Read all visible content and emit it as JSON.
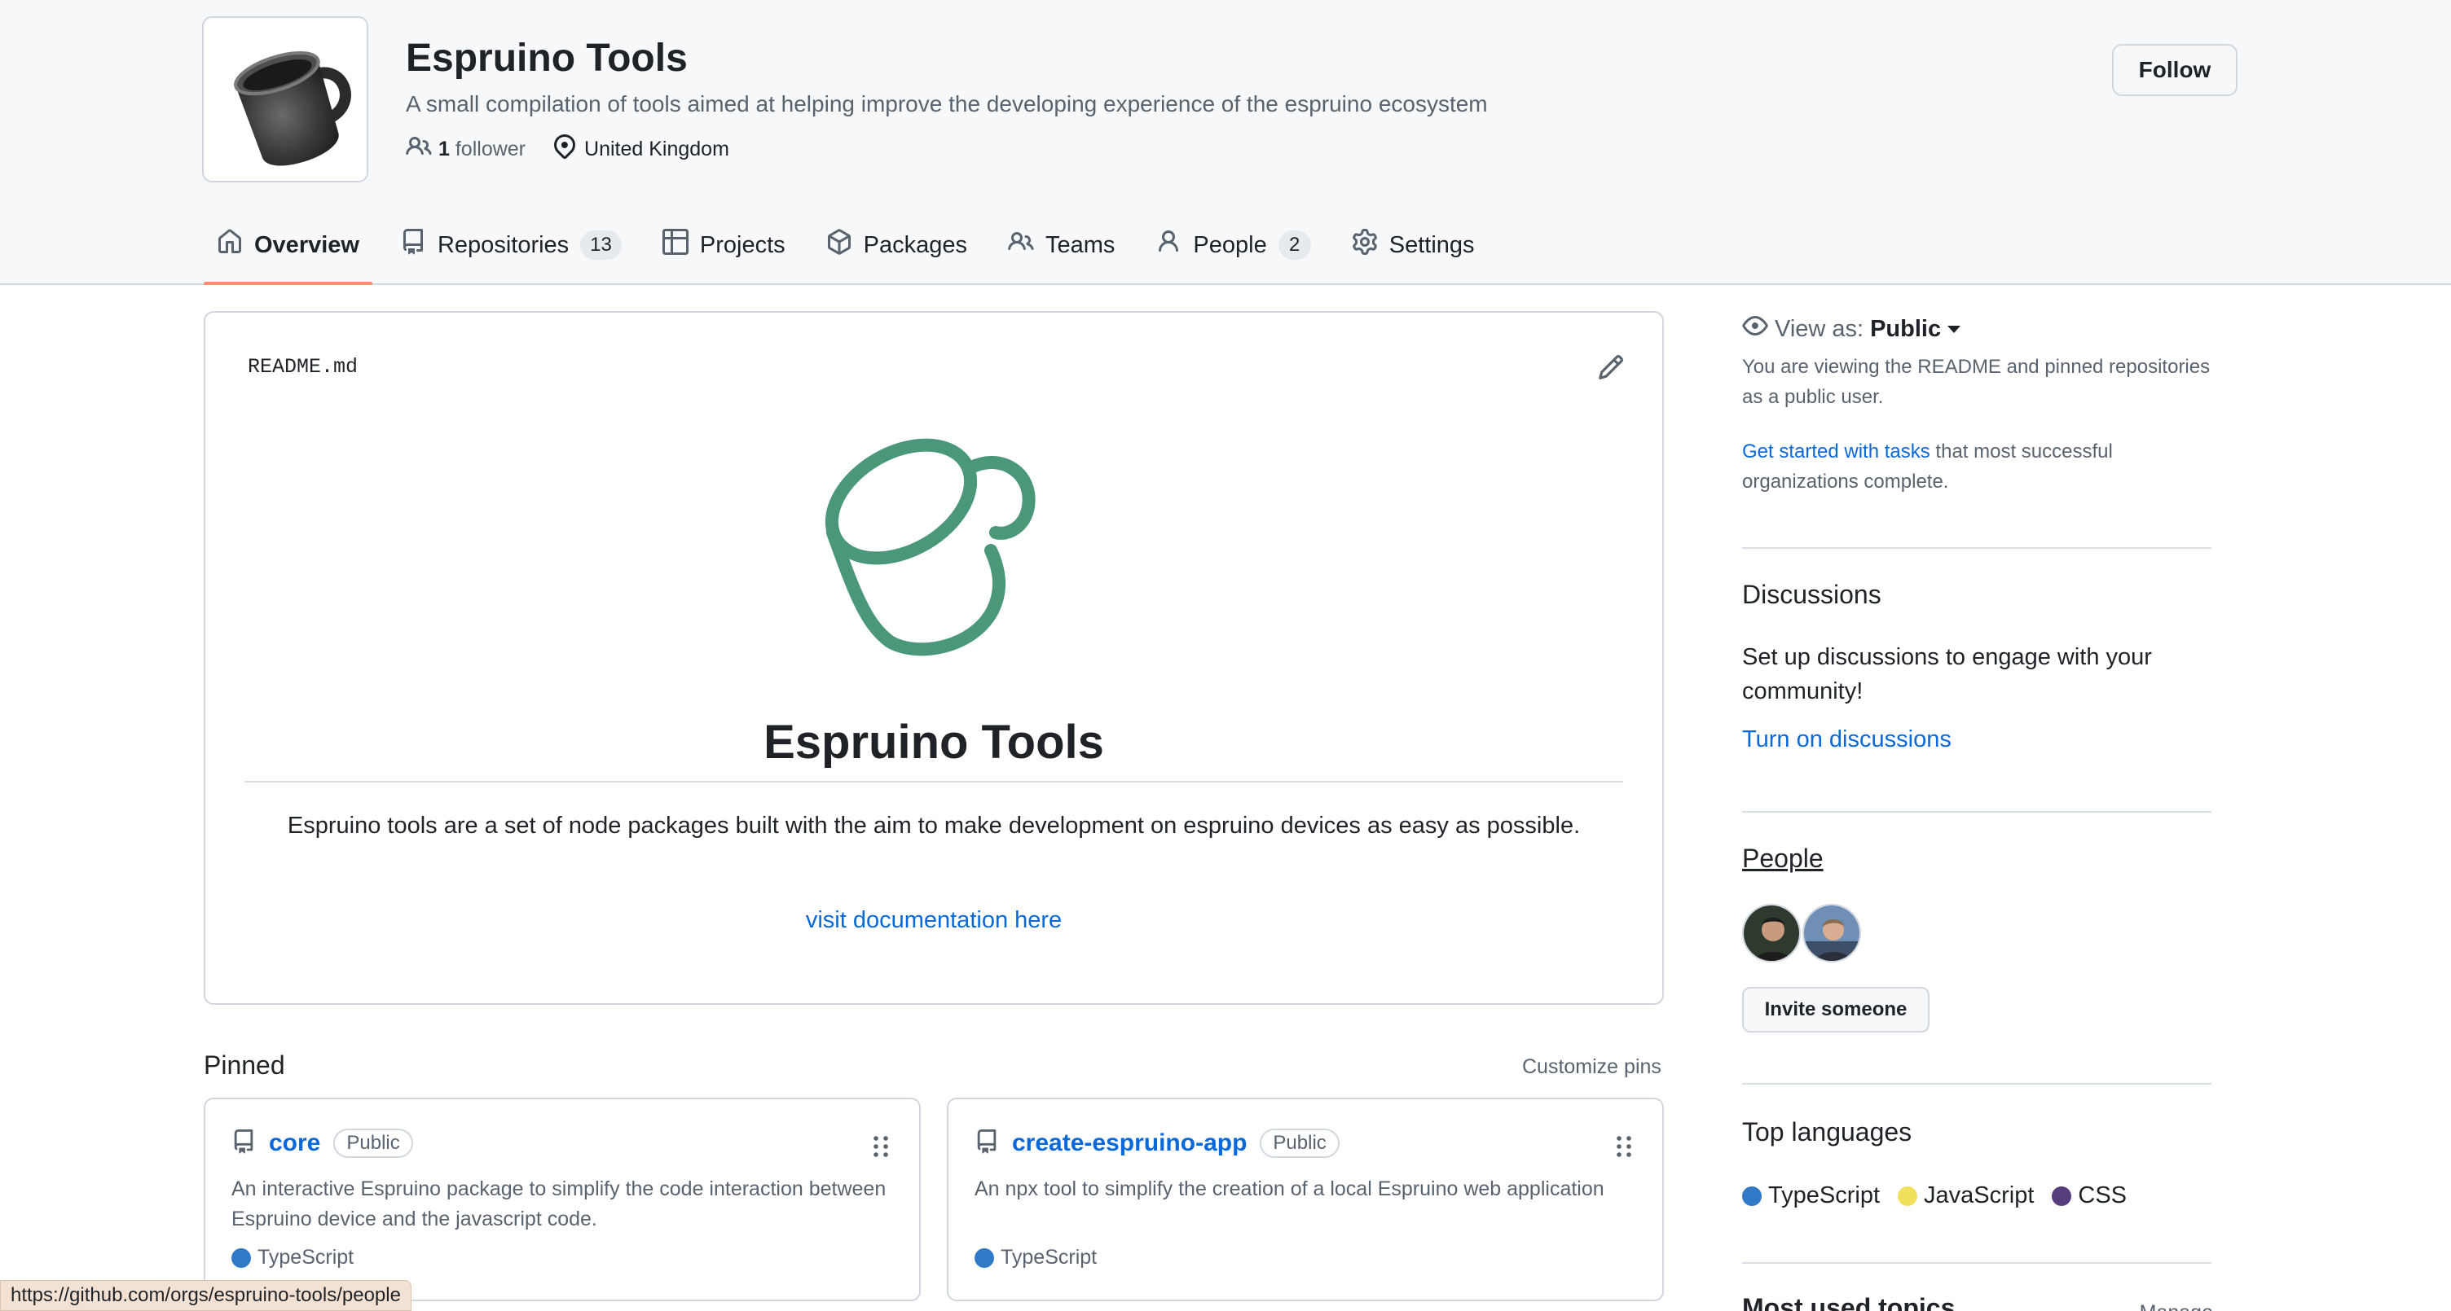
{
  "org": {
    "name": "Espruino Tools",
    "description": "A small compilation of tools aimed at helping improve the developing experience of the espruino ecosystem",
    "followers_count": "1",
    "followers_label": "follower",
    "location": "United Kingdom",
    "follow_label": "Follow"
  },
  "tabs": [
    {
      "label": "Overview",
      "icon": "home-icon",
      "selected": true
    },
    {
      "label": "Repositories",
      "icon": "repo-icon",
      "count": "13"
    },
    {
      "label": "Projects",
      "icon": "table-icon"
    },
    {
      "label": "Packages",
      "icon": "package-icon"
    },
    {
      "label": "Teams",
      "icon": "people-icon"
    },
    {
      "label": "People",
      "icon": "person-icon",
      "count": "2"
    },
    {
      "label": "Settings",
      "icon": "gear-icon"
    }
  ],
  "readme": {
    "filename": "README.md",
    "heading": "Espruino Tools",
    "text": "Espruino tools are a set of node packages built with the aim to make development on espruino devices as easy as possible.",
    "link": "visit documentation here",
    "logo_color": "#4a977a"
  },
  "pinned": {
    "title": "Pinned",
    "customize": "Customize pins",
    "repos": [
      {
        "name": "core",
        "visibility": "Public",
        "description": "An interactive Espruino package to simplify the code interaction between Espruino device and the javascript code.",
        "language": "TypeScript",
        "language_color": "#3178c6"
      },
      {
        "name": "create-espruino-app",
        "visibility": "Public",
        "description": "An npx tool to simplify the creation of a local Espruino web application",
        "language": "TypeScript",
        "language_color": "#3178c6"
      }
    ]
  },
  "sidebar": {
    "view_as_label": "View as:",
    "view_as_value": "Public",
    "view_as_desc": "You are viewing the README and pinned repositories as a public user.",
    "tasks_link": "Get started with tasks",
    "tasks_text": " that most successful organizations complete.",
    "discussions_title": "Discussions",
    "discussions_text": "Set up discussions to engage with your community!",
    "discussions_link": "Turn on discussions",
    "people_title": "People",
    "invite_label": "Invite someone",
    "top_languages_title": "Top languages",
    "languages": [
      {
        "name": "TypeScript",
        "color": "#3178c6"
      },
      {
        "name": "JavaScript",
        "color": "#f1e05a"
      },
      {
        "name": "CSS",
        "color": "#563d7c"
      }
    ],
    "topics_title": "Most used topics",
    "topics_manage": "Manage"
  },
  "status_url": "https://github.com/orgs/espruino-tools/people"
}
